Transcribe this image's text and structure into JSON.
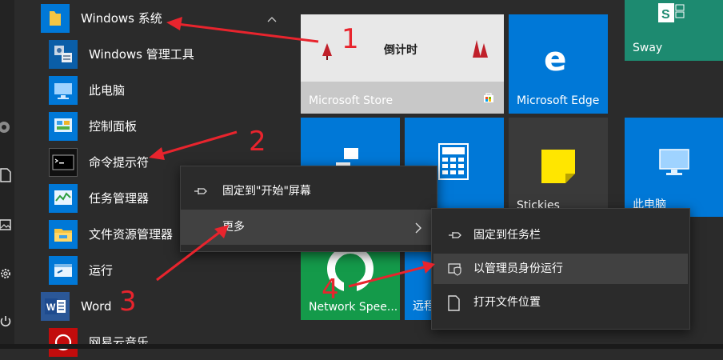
{
  "start_list": {
    "group_label": "Windows 系统",
    "items": [
      {
        "label": "Windows 管理工具",
        "icon": "admin-tools-icon"
      },
      {
        "label": "此电脑",
        "icon": "this-pc-icon"
      },
      {
        "label": "控制面板",
        "icon": "control-panel-icon"
      },
      {
        "label": "命令提示符",
        "icon": "command-prompt-icon"
      },
      {
        "label": "任务管理器",
        "icon": "task-manager-icon"
      },
      {
        "label": "文件资源管理器",
        "icon": "file-explorer-icon"
      },
      {
        "label": "运行",
        "icon": "run-icon"
      }
    ],
    "word_label": "Word",
    "netease_label": "网易云音乐"
  },
  "tiles": {
    "sway": "Sway",
    "store": "Microsoft Store",
    "store_banner": "倒计时",
    "edge": "Microsoft Edge",
    "stickies": "Stickies",
    "this_pc": "此电脑",
    "network_speed": "Network Spee...",
    "remote": "远程"
  },
  "context_menu": {
    "pin_start": "固定到\"开始\"屏幕",
    "more": "更多"
  },
  "submenu": {
    "pin_taskbar": "固定到任务栏",
    "run_as_admin": "以管理员身份运行",
    "open_location": "打开文件位置"
  },
  "annotations": [
    "1",
    "2",
    "3",
    "4"
  ],
  "colors": {
    "accent_tile": "#0078d7",
    "sway_tile": "#1d8a70",
    "annotation": "#e8242d",
    "menu_bg": "#2b2b2b",
    "highlight": "#414141"
  }
}
